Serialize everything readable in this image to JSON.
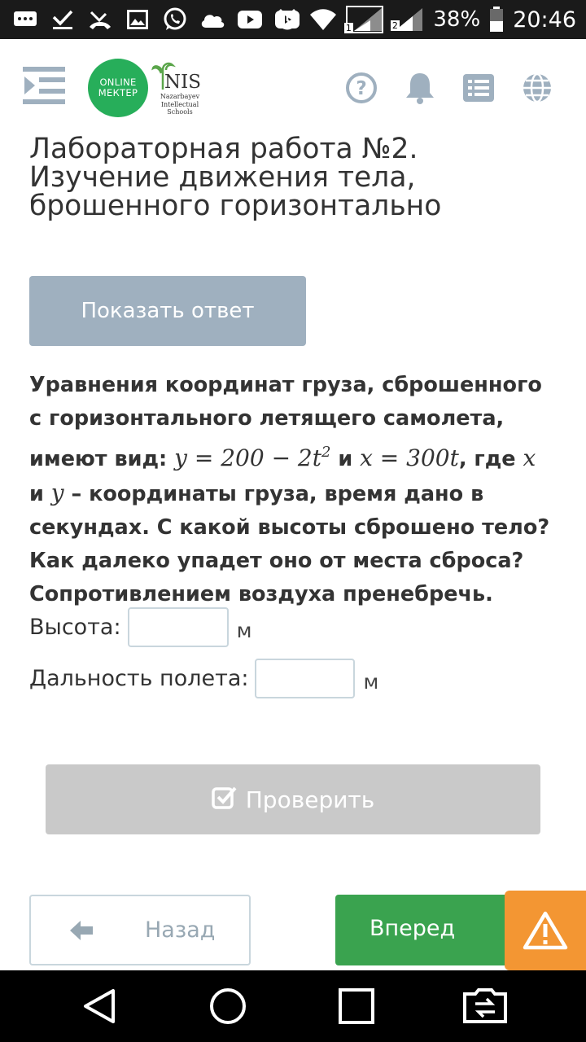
{
  "status_bar": {
    "battery": "38%",
    "time": "20:46",
    "sim1": "1",
    "sim2": "2",
    "icons": [
      "message-icon",
      "check-icon",
      "missed-call-icon",
      "image-icon",
      "whatsapp-icon",
      "cloud-icon",
      "youtube-icon",
      "youtube-icon",
      "alarm-icon",
      "wifi-icon",
      "signal-icon",
      "battery-icon"
    ]
  },
  "header": {
    "logo_line1": "ONLINE",
    "logo_line2": "МЕКТЕР",
    "nis_logo": "NIS",
    "nis_sub1": "Nazarbayev",
    "nis_sub2": "Intellectual",
    "nis_sub3": "Schools",
    "icons": [
      "menu-icon",
      "help-icon",
      "bell-icon",
      "list-icon",
      "globe-icon"
    ]
  },
  "page": {
    "title": "Лабораторная работа №2. Изучение движения тела, брошенного горизонтально",
    "show_answer": "Показать ответ"
  },
  "question": {
    "line1": "Уравнения координат груза, сброшенного",
    "line2": "с горизонтального летящего самолета,",
    "line3_a": "имеют вид: ",
    "eq_y": "y = 200 − 2t",
    "eq_y_exp": "2",
    "and1": " и ",
    "eq_x": "x = 300t",
    "where": ", где ",
    "var_x": "x",
    "line4_a": "и ",
    "var_y": "y",
    "line4_b": " – координаты груза, время дано в",
    "line5": "секундах. С какой высоты сброшено тело?",
    "line6": "Как далеко упадет оно от места сброса?",
    "line7": "Сопротивлением воздуха пренебречь."
  },
  "answers": {
    "height_label": "Высота:",
    "height_value": "",
    "height_unit": "м",
    "distance_label": "Дальность полета:",
    "distance_value": "",
    "distance_unit": "м"
  },
  "actions": {
    "check": "Проверить",
    "back": "Назад",
    "forward": "Вперед"
  },
  "colors": {
    "accent_green": "#3aa34f",
    "logo_green": "#27ae5a",
    "show_answer_bg": "#9fb0bf",
    "check_bg": "#c9c9c9",
    "warning_orange": "#f39633",
    "header_icon": "#9fb0bf"
  }
}
